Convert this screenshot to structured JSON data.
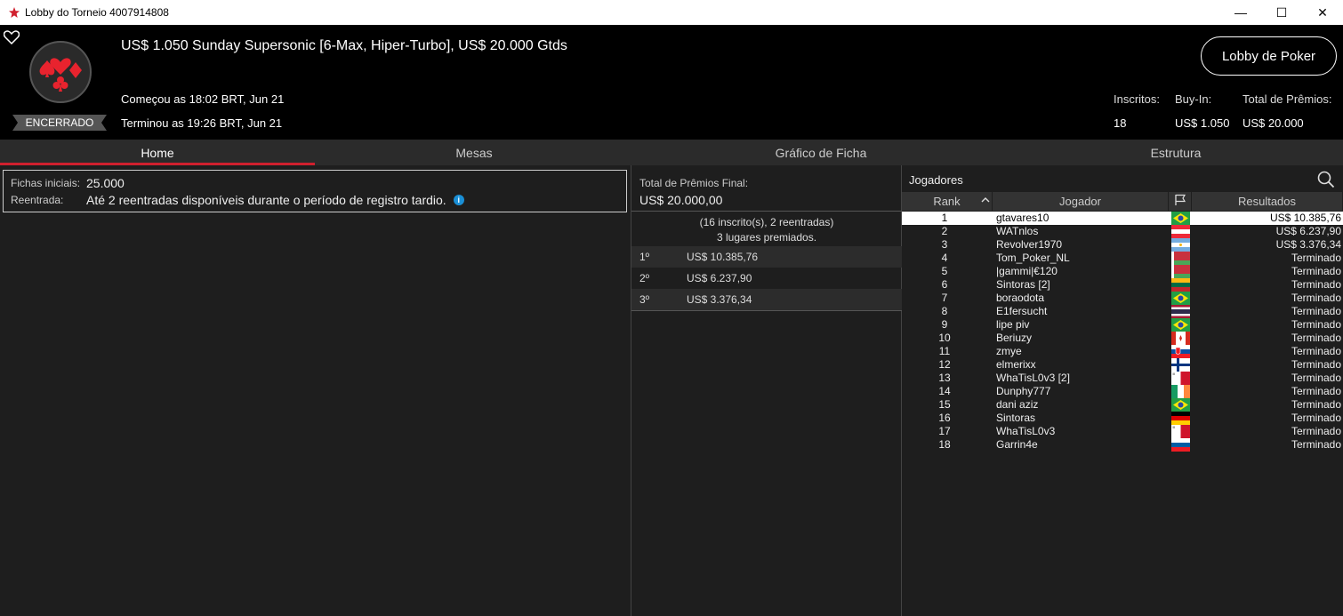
{
  "window": {
    "title": "Lobby do Torneio 4007914808",
    "minimize": "—",
    "maximize": "☐",
    "close": "✕"
  },
  "header": {
    "tournament_title": "US$ 1.050 Sunday Supersonic [6-Max, Hiper-Turbo], US$ 20.000 Gtds",
    "status": "ENCERRADO",
    "started": "Começou as 18:02 BRT, Jun 21",
    "ended": "Terminou as 19:26 BRT, Jun 21",
    "lobby_button": "Lobby de Poker",
    "stats": {
      "entrants_label": "Inscritos:",
      "entrants_value": "18",
      "buyin_label": "Buy-In:",
      "buyin_value": "US$ 1.050",
      "prize_label": "Total de Prêmios:",
      "prize_value": "US$ 20.000"
    }
  },
  "tabs": [
    "Home",
    "Mesas",
    "Gráfico de Ficha",
    "Estrutura"
  ],
  "info": {
    "chips_label": "Fichas iniciais:",
    "chips_value": "25.000",
    "reentry_label": "Reentrada:",
    "reentry_value": "Até 2 reentradas disponíveis durante o período de registro tardio."
  },
  "prizes": {
    "total_label": "Total de Prêmios Final:",
    "total_value": "US$ 20.000,00",
    "entrants_text": "(16 inscrito(s), 2 reentradas)",
    "places_text": "3 lugares premiados.",
    "rows": [
      {
        "pos": "1º",
        "amount": "US$ 10.385,76"
      },
      {
        "pos": "2º",
        "amount": "US$ 6.237,90"
      },
      {
        "pos": "3º",
        "amount": "US$ 3.376,34"
      }
    ]
  },
  "players": {
    "title": "Jogadores",
    "columns": {
      "rank": "Rank",
      "player": "Jogador",
      "results": "Resultados"
    },
    "rows": [
      {
        "rank": "1",
        "name": "gtavares10",
        "flag": "brazil",
        "result": "US$ 10.385,76"
      },
      {
        "rank": "2",
        "name": "WATnlos",
        "flag": "austria",
        "result": "US$ 6.237,90"
      },
      {
        "rank": "3",
        "name": "Revolver1970",
        "flag": "argentina",
        "result": "US$ 3.376,34"
      },
      {
        "rank": "4",
        "name": "Tom_Poker_NL",
        "flag": "belarus",
        "result": "Terminado"
      },
      {
        "rank": "5",
        "name": "|gammi|€120",
        "flag": "belarus",
        "result": "Terminado"
      },
      {
        "rank": "6",
        "name": "Sintoras [2]",
        "flag": "lithuania",
        "result": "Terminado"
      },
      {
        "rank": "7",
        "name": "boraodota",
        "flag": "brazil",
        "result": "Terminado"
      },
      {
        "rank": "8",
        "name": "E1fersucht",
        "flag": "thailand",
        "result": "Terminado"
      },
      {
        "rank": "9",
        "name": "lipe piv",
        "flag": "brazil",
        "result": "Terminado"
      },
      {
        "rank": "10",
        "name": "Beriuzy",
        "flag": "canada",
        "result": "Terminado"
      },
      {
        "rank": "11",
        "name": "zmye",
        "flag": "slovakia",
        "result": "Terminado"
      },
      {
        "rank": "12",
        "name": "elmerixx",
        "flag": "finland",
        "result": "Terminado"
      },
      {
        "rank": "13",
        "name": "WhaTisL0v3 [2]",
        "flag": "malta",
        "result": "Terminado"
      },
      {
        "rank": "14",
        "name": "Dunphy777",
        "flag": "ireland",
        "result": "Terminado"
      },
      {
        "rank": "15",
        "name": "dani aziz",
        "flag": "brazil",
        "result": "Terminado"
      },
      {
        "rank": "16",
        "name": "Sintoras",
        "flag": "germany",
        "result": "Terminado"
      },
      {
        "rank": "17",
        "name": "WhaTisL0v3",
        "flag": "malta",
        "result": "Terminado"
      },
      {
        "rank": "18",
        "name": "Garrin4e",
        "flag": "slovenia",
        "result": "Terminado"
      }
    ]
  },
  "colors": {
    "accent": "#d0202e",
    "header_bg": "#000000",
    "panel_bg": "#1e1e1e",
    "info_icon": "#1a8fd6"
  }
}
